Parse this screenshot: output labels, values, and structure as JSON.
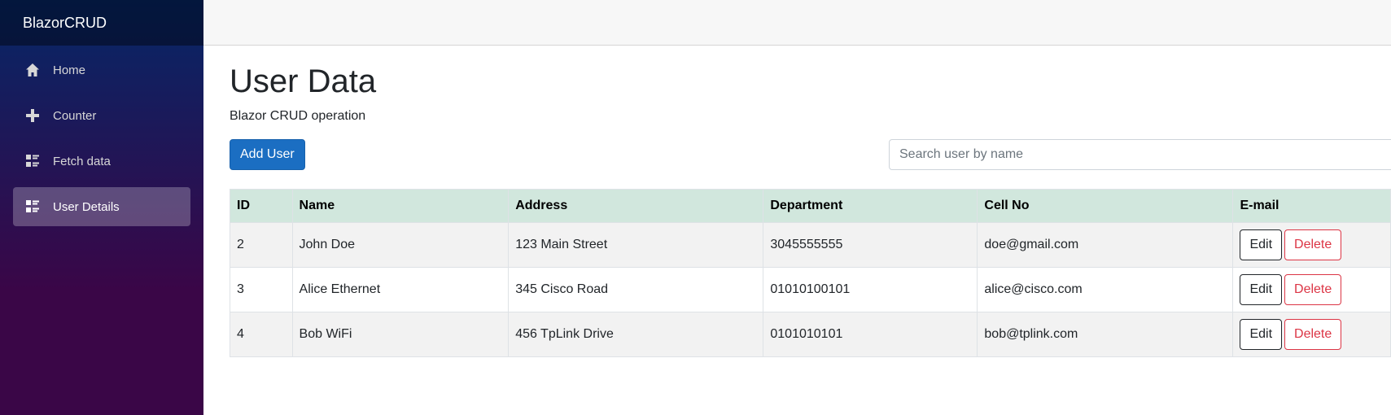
{
  "sidebar": {
    "brand": "BlazorCRUD",
    "items": [
      {
        "label": "Home",
        "icon": "home-icon"
      },
      {
        "label": "Counter",
        "icon": "plus-icon"
      },
      {
        "label": "Fetch data",
        "icon": "list-rich-icon"
      },
      {
        "label": "User Details",
        "icon": "list-rich-icon",
        "active": true
      }
    ]
  },
  "main": {
    "title": "User Data",
    "subtitle": "Blazor CRUD operation",
    "add_button": "Add User",
    "search_placeholder": "Search user by name",
    "table": {
      "headers": [
        "ID",
        "Name",
        "Address",
        "Department",
        "Cell No",
        "E-mail"
      ],
      "rows": [
        {
          "id": "2",
          "name": "John Doe",
          "address": "123 Main Street",
          "department": "3045555555",
          "cell": "doe@gmail.com"
        },
        {
          "id": "3",
          "name": "Alice Ethernet",
          "address": "345 Cisco Road",
          "department": "01010100101",
          "cell": "alice@cisco.com"
        },
        {
          "id": "4",
          "name": "Bob WiFi",
          "address": "456 TpLink Drive",
          "department": "0101010101",
          "cell": "bob@tplink.com"
        }
      ],
      "edit_label": "Edit",
      "delete_label": "Delete"
    }
  },
  "colors": {
    "primary": "#1b6ec2",
    "danger": "#dc3545",
    "header_row": "#d1e7dd",
    "sidebar_top": "#052767",
    "sidebar_bottom": "#3a0647"
  }
}
